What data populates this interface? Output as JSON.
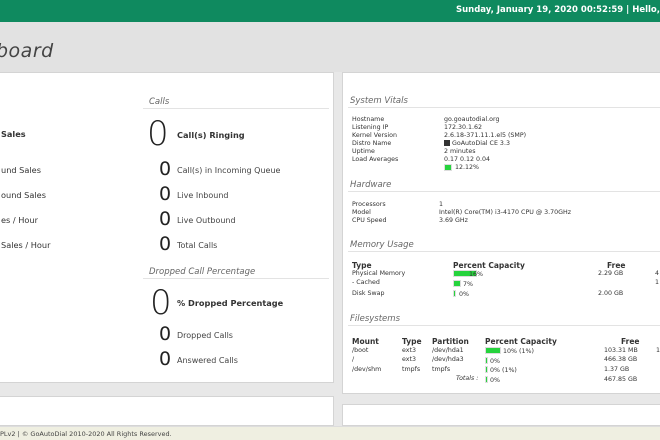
{
  "header": {
    "datetime_user": "Sunday, January 19, 2020 00:52:59 | Hello,"
  },
  "page": {
    "title": "board"
  },
  "sales": {
    "items": [
      "Sales",
      "und Sales",
      "ound Sales",
      "es / Hour",
      "Sales / Hour"
    ]
  },
  "calls": {
    "heading": "Calls",
    "ringing": {
      "value": "0",
      "label": "Call(s) Ringing"
    },
    "rows": [
      {
        "value": "0",
        "label": "Call(s) in Incoming Queue"
      },
      {
        "value": "0",
        "label": "Live Inbound"
      },
      {
        "value": "0",
        "label": "Live Outbound"
      },
      {
        "value": "0",
        "label": "Total Calls"
      }
    ]
  },
  "dropped": {
    "heading": "Dropped Call Percentage",
    "main": {
      "value": "0",
      "label": "% Dropped Percentage"
    },
    "rows": [
      {
        "value": "0",
        "label": "Dropped Calls"
      },
      {
        "value": "0",
        "label": "Answered Calls"
      }
    ]
  },
  "vitals": {
    "heading": "System Vitals",
    "rows": [
      {
        "label": "Hostname",
        "value": "go.goautodial.org"
      },
      {
        "label": "Listening IP",
        "value": "172.30.1.62"
      },
      {
        "label": "Kernel Version",
        "value": "2.6.18-371.11.1.el5 (SMP)"
      },
      {
        "label": "Distro Name",
        "value": "GoAutoDial CE 3.3"
      },
      {
        "label": "Uptime",
        "value": "2 minutes"
      },
      {
        "label": "Load Averages",
        "value": "0.17 0.12 0.04"
      }
    ],
    "load_percent": 12.12,
    "load_label": "12.12%"
  },
  "hardware": {
    "heading": "Hardware",
    "rows": [
      {
        "label": "Processors",
        "value": "1"
      },
      {
        "label": "Model",
        "value": "Intel(R) Core(TM) i3-4170 CPU @ 3.70GHz"
      },
      {
        "label": "CPU Speed",
        "value": "3.69 GHz"
      }
    ]
  },
  "memory": {
    "heading": "Memory Usage",
    "col_type": "Type",
    "col_capacity": "Percent Capacity",
    "col_free": "Free",
    "rows": [
      {
        "type": "Physical Memory",
        "percent": 16,
        "percent_label": "16%",
        "free": "2.29 GB",
        "extra": "4"
      },
      {
        "type": "- Cached",
        "percent": 7,
        "percent_label": "7%",
        "free": "",
        "extra": "1"
      },
      {
        "type": "Disk Swap",
        "percent": 0,
        "percent_label": "0%",
        "free": "2.00 GB",
        "extra": ""
      }
    ]
  },
  "filesystems": {
    "heading": "Filesystems",
    "col_mount": "Mount",
    "col_type": "Type",
    "col_partition": "Partition",
    "col_capacity": "Percent Capacity",
    "col_free": "Free",
    "rows": [
      {
        "mount": "/boot",
        "type": "ext3",
        "partition": "/dev/hda1",
        "percent": 10,
        "percent_label": "10% (1%)",
        "free": "103.31 MB",
        "extra": "1"
      },
      {
        "mount": "/",
        "type": "ext3",
        "partition": "/dev/hda3",
        "percent": 0,
        "percent_label": "0%",
        "free": "466.38 GB",
        "extra": ""
      },
      {
        "mount": "/dev/shm",
        "type": "tmpfs",
        "partition": "tmpfs",
        "percent": 0,
        "percent_label": "0% (1%)",
        "free": "1.37 GB",
        "extra": ""
      }
    ],
    "totals_label": "Totals :",
    "totals_percent": 0,
    "totals_percent_label": "0%",
    "totals_free": "467.85 GB"
  },
  "footer": {
    "text": "PLv2 | © GoAutoDial 2010-2020 All Rights Reserved."
  }
}
